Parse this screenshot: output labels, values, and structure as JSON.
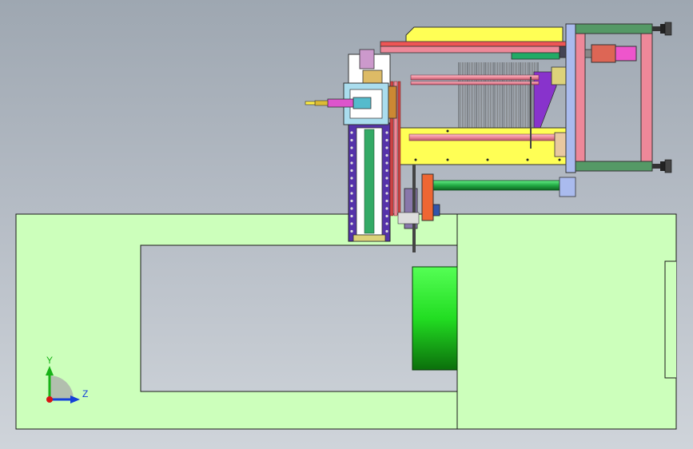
{
  "view": {
    "background_top": "#9ea7b1",
    "background_bottom": "#cfd4da"
  },
  "triad": {
    "y_label": "Y",
    "z_label": "Z",
    "y_color": "#17b217",
    "z_color": "#1440d8",
    "x_color": "#d81414"
  },
  "colors": {
    "base_plate": "#ccffbb",
    "drum": "#22dd22",
    "yellow_parts": "#ffff55",
    "pink_frame": "#ee8899",
    "green_rails": "#559966",
    "purple_column": "#5533aa",
    "orange_bracket": "#ee6633"
  }
}
